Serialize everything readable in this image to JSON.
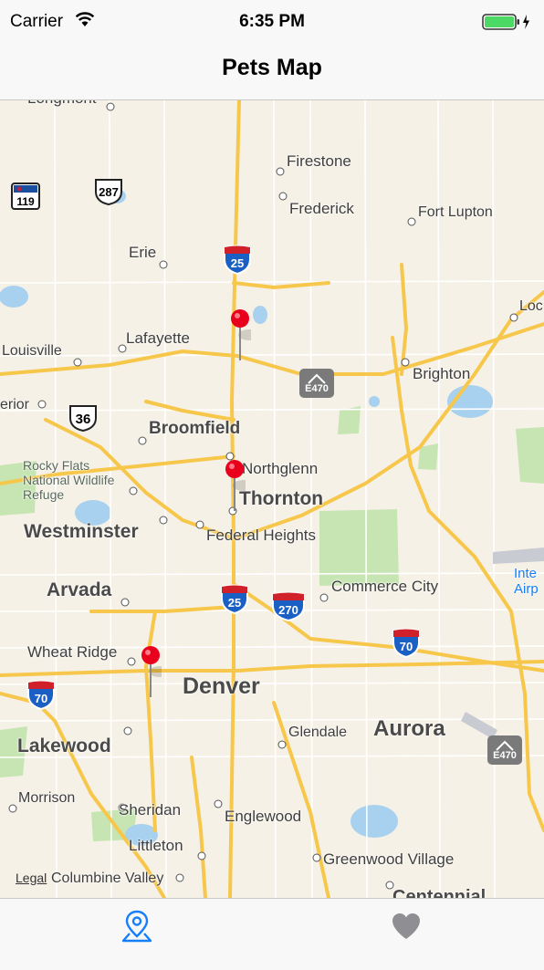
{
  "status_bar": {
    "carrier": "Carrier",
    "time": "6:35 PM"
  },
  "nav": {
    "title": "Pets Map"
  },
  "map": {
    "legal": "Legal",
    "cities": [
      {
        "name": "Firestone",
        "big": false
      },
      {
        "name": "Frederick",
        "big": false
      },
      {
        "name": "Fort Lupton",
        "big": false
      },
      {
        "name": "Erie",
        "big": false
      },
      {
        "name": "Lafayette",
        "big": false
      },
      {
        "name": "Louisville",
        "big": false
      },
      {
        "name": "Brighton",
        "big": false
      },
      {
        "name": "Broomfield",
        "big": true
      },
      {
        "name": "Northglenn",
        "big": false
      },
      {
        "name": "Thornton",
        "big": true
      },
      {
        "name": "Rocky Flats National Wildlife Refuge",
        "big": false
      },
      {
        "name": "Westminster",
        "big": true
      },
      {
        "name": "Federal Heights",
        "big": false
      },
      {
        "name": "Arvada",
        "big": true
      },
      {
        "name": "Commerce City",
        "big": false
      },
      {
        "name": "Wheat Ridge",
        "big": false
      },
      {
        "name": "Denver",
        "big": true
      },
      {
        "name": "Glendale",
        "big": false
      },
      {
        "name": "Aurora",
        "big": true
      },
      {
        "name": "Lakewood",
        "big": true
      },
      {
        "name": "Morrison",
        "big": false
      },
      {
        "name": "Sheridan",
        "big": false
      },
      {
        "name": "Englewood",
        "big": false
      },
      {
        "name": "Littleton",
        "big": false
      },
      {
        "name": "Greenwood Village",
        "big": false
      },
      {
        "name": "Columbine Valley",
        "big": false
      },
      {
        "name": "Centennial",
        "big": true
      },
      {
        "name": "Loc",
        "big": false
      },
      {
        "name": "erior",
        "big": false
      },
      {
        "name": "Inte Airp",
        "big": false
      },
      {
        "name": "Longmont",
        "big": false
      }
    ],
    "shields": {
      "i25_north": "25",
      "i25_south": "25",
      "i270": "270",
      "i70_east": "70",
      "i70_west": "70",
      "us287": "287",
      "us36": "36",
      "co119": "119",
      "e470_north": "E470",
      "e470_south": "E470"
    },
    "pins": [
      "pet-location",
      "pet-location",
      "pet-location"
    ]
  },
  "tabs": [
    {
      "name": "map",
      "icon": "map-pin-icon",
      "selected": true
    },
    {
      "name": "favorites",
      "icon": "heart-icon",
      "selected": false
    }
  ],
  "colors": {
    "accent": "#147efb",
    "pin": "#e8001c",
    "road": "#f7c74b",
    "water": "#a8d0ef",
    "park": "#c6e5b3"
  }
}
